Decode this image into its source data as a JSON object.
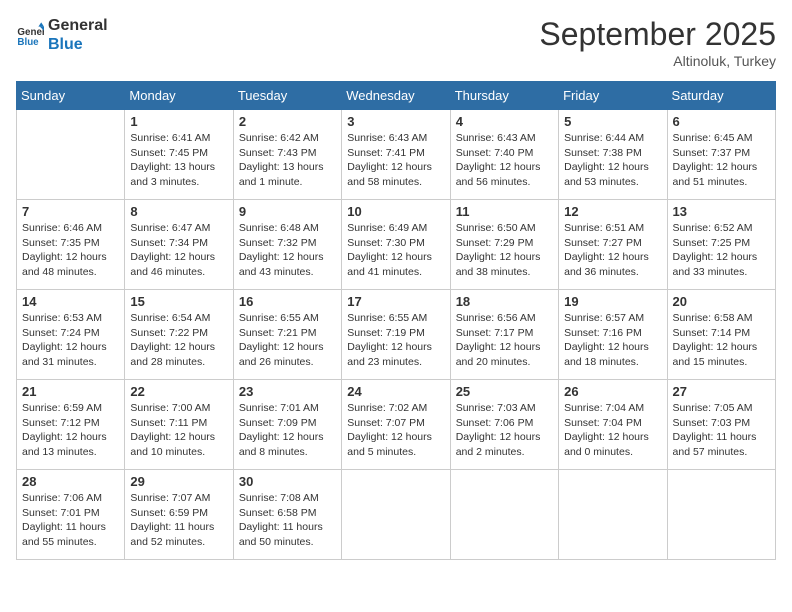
{
  "header": {
    "logo_line1": "General",
    "logo_line2": "Blue",
    "month": "September 2025",
    "location": "Altinoluk, Turkey"
  },
  "weekdays": [
    "Sunday",
    "Monday",
    "Tuesday",
    "Wednesday",
    "Thursday",
    "Friday",
    "Saturday"
  ],
  "weeks": [
    [
      {
        "day": "",
        "info": ""
      },
      {
        "day": "1",
        "info": "Sunrise: 6:41 AM\nSunset: 7:45 PM\nDaylight: 13 hours\nand 3 minutes."
      },
      {
        "day": "2",
        "info": "Sunrise: 6:42 AM\nSunset: 7:43 PM\nDaylight: 13 hours\nand 1 minute."
      },
      {
        "day": "3",
        "info": "Sunrise: 6:43 AM\nSunset: 7:41 PM\nDaylight: 12 hours\nand 58 minutes."
      },
      {
        "day": "4",
        "info": "Sunrise: 6:43 AM\nSunset: 7:40 PM\nDaylight: 12 hours\nand 56 minutes."
      },
      {
        "day": "5",
        "info": "Sunrise: 6:44 AM\nSunset: 7:38 PM\nDaylight: 12 hours\nand 53 minutes."
      },
      {
        "day": "6",
        "info": "Sunrise: 6:45 AM\nSunset: 7:37 PM\nDaylight: 12 hours\nand 51 minutes."
      }
    ],
    [
      {
        "day": "7",
        "info": "Sunrise: 6:46 AM\nSunset: 7:35 PM\nDaylight: 12 hours\nand 48 minutes."
      },
      {
        "day": "8",
        "info": "Sunrise: 6:47 AM\nSunset: 7:34 PM\nDaylight: 12 hours\nand 46 minutes."
      },
      {
        "day": "9",
        "info": "Sunrise: 6:48 AM\nSunset: 7:32 PM\nDaylight: 12 hours\nand 43 minutes."
      },
      {
        "day": "10",
        "info": "Sunrise: 6:49 AM\nSunset: 7:30 PM\nDaylight: 12 hours\nand 41 minutes."
      },
      {
        "day": "11",
        "info": "Sunrise: 6:50 AM\nSunset: 7:29 PM\nDaylight: 12 hours\nand 38 minutes."
      },
      {
        "day": "12",
        "info": "Sunrise: 6:51 AM\nSunset: 7:27 PM\nDaylight: 12 hours\nand 36 minutes."
      },
      {
        "day": "13",
        "info": "Sunrise: 6:52 AM\nSunset: 7:25 PM\nDaylight: 12 hours\nand 33 minutes."
      }
    ],
    [
      {
        "day": "14",
        "info": "Sunrise: 6:53 AM\nSunset: 7:24 PM\nDaylight: 12 hours\nand 31 minutes."
      },
      {
        "day": "15",
        "info": "Sunrise: 6:54 AM\nSunset: 7:22 PM\nDaylight: 12 hours\nand 28 minutes."
      },
      {
        "day": "16",
        "info": "Sunrise: 6:55 AM\nSunset: 7:21 PM\nDaylight: 12 hours\nand 26 minutes."
      },
      {
        "day": "17",
        "info": "Sunrise: 6:55 AM\nSunset: 7:19 PM\nDaylight: 12 hours\nand 23 minutes."
      },
      {
        "day": "18",
        "info": "Sunrise: 6:56 AM\nSunset: 7:17 PM\nDaylight: 12 hours\nand 20 minutes."
      },
      {
        "day": "19",
        "info": "Sunrise: 6:57 AM\nSunset: 7:16 PM\nDaylight: 12 hours\nand 18 minutes."
      },
      {
        "day": "20",
        "info": "Sunrise: 6:58 AM\nSunset: 7:14 PM\nDaylight: 12 hours\nand 15 minutes."
      }
    ],
    [
      {
        "day": "21",
        "info": "Sunrise: 6:59 AM\nSunset: 7:12 PM\nDaylight: 12 hours\nand 13 minutes."
      },
      {
        "day": "22",
        "info": "Sunrise: 7:00 AM\nSunset: 7:11 PM\nDaylight: 12 hours\nand 10 minutes."
      },
      {
        "day": "23",
        "info": "Sunrise: 7:01 AM\nSunset: 7:09 PM\nDaylight: 12 hours\nand 8 minutes."
      },
      {
        "day": "24",
        "info": "Sunrise: 7:02 AM\nSunset: 7:07 PM\nDaylight: 12 hours\nand 5 minutes."
      },
      {
        "day": "25",
        "info": "Sunrise: 7:03 AM\nSunset: 7:06 PM\nDaylight: 12 hours\nand 2 minutes."
      },
      {
        "day": "26",
        "info": "Sunrise: 7:04 AM\nSunset: 7:04 PM\nDaylight: 12 hours\nand 0 minutes."
      },
      {
        "day": "27",
        "info": "Sunrise: 7:05 AM\nSunset: 7:03 PM\nDaylight: 11 hours\nand 57 minutes."
      }
    ],
    [
      {
        "day": "28",
        "info": "Sunrise: 7:06 AM\nSunset: 7:01 PM\nDaylight: 11 hours\nand 55 minutes."
      },
      {
        "day": "29",
        "info": "Sunrise: 7:07 AM\nSunset: 6:59 PM\nDaylight: 11 hours\nand 52 minutes."
      },
      {
        "day": "30",
        "info": "Sunrise: 7:08 AM\nSunset: 6:58 PM\nDaylight: 11 hours\nand 50 minutes."
      },
      {
        "day": "",
        "info": ""
      },
      {
        "day": "",
        "info": ""
      },
      {
        "day": "",
        "info": ""
      },
      {
        "day": "",
        "info": ""
      }
    ]
  ]
}
